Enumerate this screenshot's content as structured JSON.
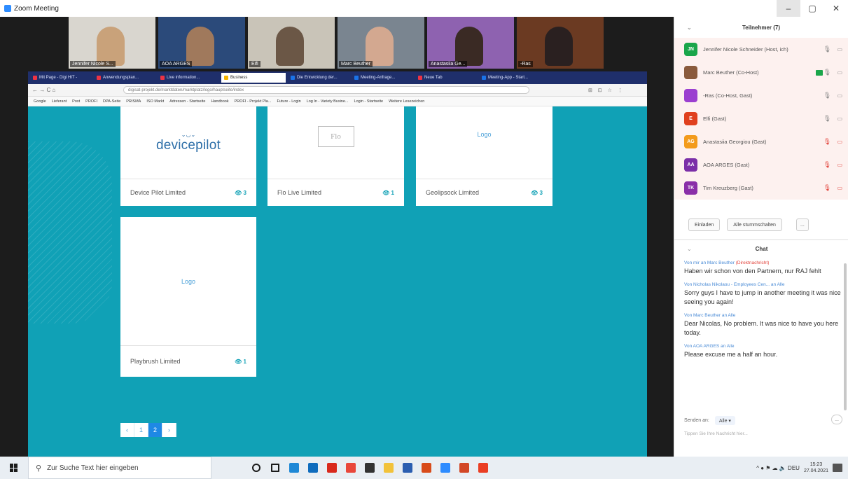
{
  "zoom": {
    "title": "Zoom Meeting",
    "window_controls": [
      "–",
      "▢",
      "✕"
    ]
  },
  "videos": [
    {
      "name": "Jennifer Nicole S...",
      "bg": "#d9d6cf",
      "person": "#c9a27a"
    },
    {
      "name": "AOA ARGES",
      "bg": "#2b4a7a",
      "person": "#a0795c"
    },
    {
      "name": "Eifi",
      "bg": "#c9c4b8",
      "person": "#6b5746"
    },
    {
      "name": "Marc Beuther",
      "bg": "#7a8590",
      "person": "#d3a890"
    },
    {
      "name": "Anastasiia Ge...",
      "bg": "#8e62b0",
      "person": "#3a2a24"
    },
    {
      "name": "-Ras",
      "bg": "#6b3a22",
      "person": "#2a2020"
    }
  ],
  "browser": {
    "tabs": [
      {
        "label": "Mit Page - Digi HIT -",
        "color": "#e34"
      },
      {
        "label": "Anwendungsplan...",
        "color": "#e34"
      },
      {
        "label": "Live information...",
        "color": "#e34"
      },
      {
        "label": "Business",
        "color": "#f5b400",
        "active": true
      },
      {
        "label": "Die Entwicklung der...",
        "color": "#1a73e8"
      },
      {
        "label": "Meeting-Anfrage...",
        "color": "#1a73e8"
      },
      {
        "label": "Neue Tab",
        "color": "#e34"
      },
      {
        "label": "Meeting-App - Start...",
        "color": "#1a73e8"
      }
    ],
    "nav": "← → C ⌂",
    "url": "digisat-projekt.de/marktdaten/marktplatz/logo/hauptseite/index",
    "extensions": "⊞ ⊡ ☆ ⋮",
    "bookmarks": [
      "Google",
      "Lieferant",
      "Post",
      "PROFI",
      "DPA-Seite",
      "PRISMA",
      "ISO Markt",
      "Adressen - Startseite",
      "Handbook",
      "PROFI - Projekt Pla...",
      "Future - Login",
      "Log In - Variety Busine...",
      "Login - Startseite",
      "Weitere Lesezeichen"
    ]
  },
  "cards": [
    {
      "logo": "devicepilot",
      "company": "Device Pilot Limited",
      "views": "👁 3"
    },
    {
      "logo": "Flo",
      "company": "Flo Live Limited",
      "views": "👁 1"
    },
    {
      "logo": "Logo",
      "company": "Geolipsock Limited",
      "views": "👁 3"
    },
    {
      "logo": "Logo",
      "company": "Playbrush Limited",
      "views": "👁 1"
    }
  ],
  "pagination": [
    "‹",
    "1",
    "2",
    "›"
  ],
  "panel": {
    "participants_title": "Teilnehmer (7)",
    "participants": [
      {
        "initials": "JN",
        "name": "Jennifer Nicole Schneider (Host, ich)",
        "color": "#1aa64a",
        "mic": "🎙",
        "muted": false
      },
      {
        "initials": "",
        "name": "Marc Beuther (Co-Host)",
        "color": "#8a5a3c",
        "mic": "🎙",
        "muted": false
      },
      {
        "initials": "",
        "name": "-Ras (Co-Host, Gast)",
        "color": "#9b3fd0",
        "mic": "🎙",
        "muted": false
      },
      {
        "initials": "E",
        "name": "Elfi (Gast)",
        "color": "#e0401e",
        "mic": "🎙",
        "muted": false
      },
      {
        "initials": "AG",
        "name": "Anastasiia Georgiou (Gast)",
        "color": "#f39b1c",
        "mic": "🎙",
        "muted": true
      },
      {
        "initials": "AA",
        "name": "AOA ARGES (Gast)",
        "color": "#7b2fa8",
        "mic": "🎙",
        "muted": true
      },
      {
        "initials": "TK",
        "name": "Tim Kreuzberg (Gast)",
        "color": "#8a2fa8",
        "mic": "🎙",
        "muted": true
      }
    ],
    "invite_label": "Einladen",
    "mute_all_label": "Alle stummschalten",
    "more_label": "...",
    "chat_title": "Chat",
    "messages": [
      {
        "meta": "Von mir an Marc Beuther",
        "private": "(Direktnachricht)",
        "text": "Haben wir schon von den Partnern, nur RAJ fehlt"
      },
      {
        "meta": "Von Nicholas Nikolaou - Employees Cen... an Alle",
        "private": "",
        "text": "Sorry guys I have to jump in another meeting it was nice seeing you again!"
      },
      {
        "meta": "Von Marc Beuther an Alle",
        "private": "",
        "text": "Dear Nicolas, No problem. It was nice to have you here today."
      },
      {
        "meta": "Von AOA ARGES an Alle",
        "private": "",
        "text": "Please excuse me a half an hour."
      }
    ],
    "send_to_label": "Senden an:",
    "send_to_value": "Alle ▾",
    "input_placeholder": "Tippen Sie Ihre Nachricht hier..."
  },
  "taskbar": {
    "search_placeholder": "Zur Suche Text hier eingeben",
    "apps": [
      {
        "name": "cortana-icon",
        "color": "#1b1b1b"
      },
      {
        "name": "task-view-icon",
        "color": "#1b1b1b"
      },
      {
        "name": "edge-icon",
        "color": "#1e88d6"
      },
      {
        "name": "outlook-icon",
        "color": "#0f6cbd"
      },
      {
        "name": "acrobat-icon",
        "color": "#d9291c"
      },
      {
        "name": "chrome-icon",
        "color": "#e9473a"
      },
      {
        "name": "store-icon",
        "color": "#333333"
      },
      {
        "name": "explorer-icon",
        "color": "#f2c23a"
      },
      {
        "name": "word-icon",
        "color": "#2b5eb0"
      },
      {
        "name": "office-icon",
        "color": "#d84b1a"
      },
      {
        "name": "zoom-icon",
        "color": "#2d8cff"
      },
      {
        "name": "powerpoint-icon",
        "color": "#d24726"
      },
      {
        "name": "office-hub-icon",
        "color": "#ea3e23"
      }
    ],
    "tray_icons": "^ ● ⚑ ☁ 🔈 DEU",
    "time": "15:23",
    "date": "27.04.2021"
  }
}
